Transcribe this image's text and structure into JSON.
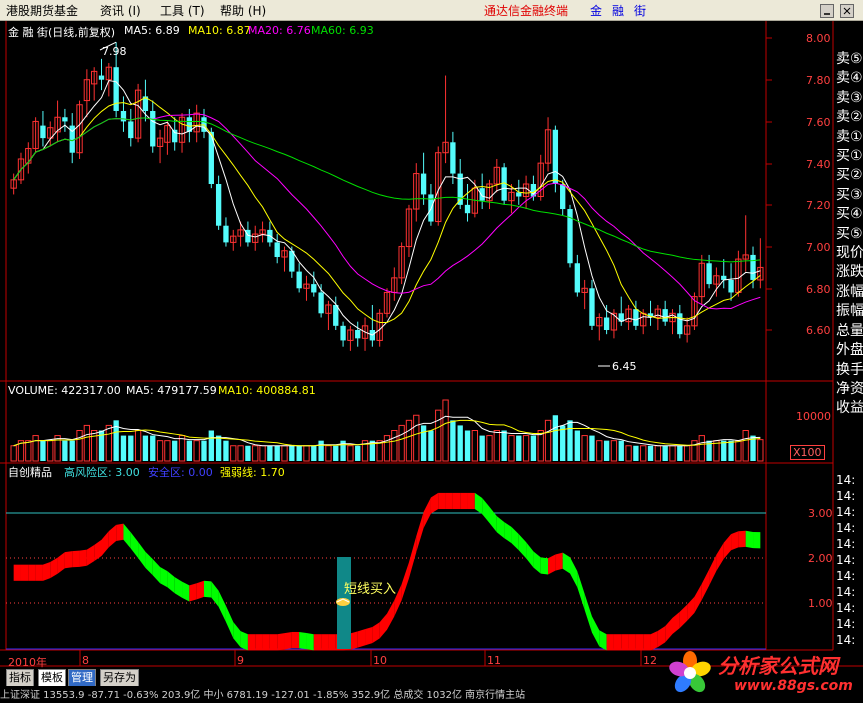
{
  "menubar": {
    "items": [
      {
        "label": "港股期货基金"
      },
      {
        "label": "资讯 (I)"
      },
      {
        "label": "工具 (T)"
      },
      {
        "label": "帮助 (H)"
      }
    ],
    "terminal_title": "通达信金融终端",
    "brand": [
      "金",
      "融",
      "街"
    ],
    "window_controls": [
      "minimize-icon",
      "close-icon"
    ]
  },
  "price_panel": {
    "stock_label": "金 融 街(日线,前复权)",
    "ma5": "MA5: 6.89",
    "ma10": "MA10: 6.87",
    "ma20": "MA20: 6.76",
    "ma60": "MA60: 6.93",
    "high_label": "7.98",
    "low_label": "6.45",
    "y_ticks": [
      "8.00",
      "7.80",
      "7.60",
      "7.40",
      "7.20",
      "7.00",
      "6.80",
      "6.60"
    ]
  },
  "volume_panel": {
    "label": "VOLUME: 422317.00",
    "ma5": "MA5: 479177.59",
    "ma10": "MA10: 400884.81",
    "tick": "10000",
    "unit": "X100"
  },
  "indicator_panel": {
    "name": "自创精品",
    "high_risk": "高风险区: 3.00",
    "safe": "安全区: 0.00",
    "strength": "强弱线: 1.70",
    "signal_text": "短线买入",
    "y_ticks": [
      "3.00",
      "2.00",
      "1.00"
    ]
  },
  "x_axis": {
    "labels": [
      "2010年",
      "8",
      "9",
      "10",
      "11",
      "12"
    ]
  },
  "side_panel": {
    "labels": [
      "卖⑤",
      "卖④",
      "卖③",
      "卖②",
      "卖①",
      "买①",
      "买②",
      "买③",
      "买④",
      "买⑤",
      "现价",
      "涨跌",
      "涨幅",
      "振幅",
      "总量",
      "外盘",
      "换手",
      "净资",
      "收益"
    ],
    "times": [
      "14:",
      "14:",
      "14:",
      "14:",
      "14:",
      "14:",
      "14:",
      "14:",
      "14:",
      "14:",
      "14:"
    ]
  },
  "bottom_tabs": [
    "指标",
    "模板",
    "管理",
    "另存为"
  ],
  "status_bar": {
    "text": "上证深证 13553.9  -87.71  -0.63%  203.9亿  中小 6781.19  -127.01  -1.85%  352.9亿  总成交  1032亿  南京行情主站"
  },
  "watermark": {
    "title": "分析家公式网",
    "url": "www.88gs.com"
  },
  "colors": {
    "up": "#ff3232",
    "down": "#54fcfc",
    "ma5": "#ffffff",
    "ma10": "#ffff00",
    "ma20": "#ff00ff",
    "ma60": "#00e000",
    "band_up": "#ff0000",
    "band_down": "#00ff00"
  },
  "chart_data": [
    {
      "type": "candlestick",
      "title": "金 融 街(日线,前复权)",
      "ylim": [
        6.45,
        8.0
      ],
      "grid": false,
      "candles_ohlc": [
        [
          7.28,
          7.35,
          7.25,
          7.32
        ],
        [
          7.32,
          7.45,
          7.3,
          7.42
        ],
        [
          7.4,
          7.5,
          7.35,
          7.47
        ],
        [
          7.47,
          7.62,
          7.45,
          7.6
        ],
        [
          7.58,
          7.65,
          7.48,
          7.52
        ],
        [
          7.52,
          7.6,
          7.48,
          7.57
        ],
        [
          7.55,
          7.7,
          7.5,
          7.62
        ],
        [
          7.62,
          7.66,
          7.55,
          7.6
        ],
        [
          7.58,
          7.64,
          7.4,
          7.45
        ],
        [
          7.45,
          7.7,
          7.42,
          7.68
        ],
        [
          7.7,
          7.85,
          7.62,
          7.8
        ],
        [
          7.78,
          7.86,
          7.7,
          7.84
        ],
        [
          7.82,
          7.9,
          7.75,
          7.8
        ],
        [
          7.8,
          7.88,
          7.72,
          7.86
        ],
        [
          7.86,
          7.98,
          7.62,
          7.65
        ],
        [
          7.65,
          7.72,
          7.55,
          7.6
        ],
        [
          7.6,
          7.66,
          7.48,
          7.52
        ],
        [
          7.52,
          7.78,
          7.5,
          7.75
        ],
        [
          7.72,
          7.8,
          7.6,
          7.65
        ],
        [
          7.65,
          7.7,
          7.45,
          7.48
        ],
        [
          7.48,
          7.56,
          7.4,
          7.52
        ],
        [
          7.5,
          7.6,
          7.44,
          7.58
        ],
        [
          7.56,
          7.62,
          7.46,
          7.5
        ],
        [
          7.5,
          7.64,
          7.45,
          7.62
        ],
        [
          7.62,
          7.66,
          7.5,
          7.55
        ],
        [
          7.55,
          7.68,
          7.5,
          7.64
        ],
        [
          7.62,
          7.66,
          7.52,
          7.55
        ],
        [
          7.55,
          7.57,
          7.28,
          7.3
        ],
        [
          7.3,
          7.34,
          7.08,
          7.1
        ],
        [
          7.1,
          7.14,
          7.0,
          7.02
        ],
        [
          7.02,
          7.08,
          6.98,
          7.05
        ],
        [
          7.05,
          7.12,
          7.0,
          7.08
        ],
        [
          7.08,
          7.12,
          7.0,
          7.02
        ],
        [
          7.02,
          7.1,
          6.98,
          7.06
        ],
        [
          7.06,
          7.12,
          7.02,
          7.08
        ],
        [
          7.08,
          7.12,
          7.0,
          7.02
        ],
        [
          7.02,
          7.06,
          6.92,
          6.95
        ],
        [
          6.95,
          7.0,
          6.88,
          6.98
        ],
        [
          6.98,
          7.0,
          6.85,
          6.88
        ],
        [
          6.88,
          6.92,
          6.78,
          6.8
        ],
        [
          6.8,
          6.86,
          6.74,
          6.82
        ],
        [
          6.82,
          6.88,
          6.76,
          6.78
        ],
        [
          6.78,
          6.82,
          6.66,
          6.68
        ],
        [
          6.68,
          6.74,
          6.6,
          6.72
        ],
        [
          6.72,
          6.76,
          6.6,
          6.62
        ],
        [
          6.62,
          6.64,
          6.52,
          6.55
        ],
        [
          6.55,
          6.62,
          6.5,
          6.6
        ],
        [
          6.6,
          6.64,
          6.52,
          6.56
        ],
        [
          6.56,
          6.66,
          6.5,
          6.62
        ],
        [
          6.6,
          6.72,
          6.52,
          6.55
        ],
        [
          6.55,
          6.7,
          6.52,
          6.68
        ],
        [
          6.68,
          6.8,
          6.66,
          6.78
        ],
        [
          6.78,
          6.9,
          6.74,
          6.85
        ],
        [
          6.85,
          7.02,
          6.82,
          7.0
        ],
        [
          7.0,
          7.2,
          6.95,
          7.18
        ],
        [
          7.18,
          7.4,
          7.12,
          7.35
        ],
        [
          7.35,
          7.45,
          7.2,
          7.25
        ],
        [
          7.25,
          7.3,
          7.1,
          7.12
        ],
        [
          7.12,
          7.48,
          7.1,
          7.45
        ],
        [
          7.45,
          7.82,
          7.4,
          7.5
        ],
        [
          7.5,
          7.55,
          7.3,
          7.35
        ],
        [
          7.35,
          7.42,
          7.18,
          7.2
        ],
        [
          7.2,
          7.3,
          7.12,
          7.16
        ],
        [
          7.16,
          7.32,
          7.14,
          7.28
        ],
        [
          7.28,
          7.35,
          7.18,
          7.22
        ],
        [
          7.22,
          7.32,
          7.18,
          7.3
        ],
        [
          7.3,
          7.42,
          7.26,
          7.38
        ],
        [
          7.38,
          7.4,
          7.2,
          7.22
        ],
        [
          7.22,
          7.3,
          7.16,
          7.26
        ],
        [
          7.26,
          7.32,
          7.2,
          7.24
        ],
        [
          7.24,
          7.34,
          7.18,
          7.3
        ],
        [
          7.3,
          7.34,
          7.22,
          7.24
        ],
        [
          7.24,
          7.44,
          7.22,
          7.4
        ],
        [
          7.4,
          7.62,
          7.36,
          7.56
        ],
        [
          7.56,
          7.58,
          7.26,
          7.3
        ],
        [
          7.3,
          7.32,
          7.15,
          7.18
        ],
        [
          7.18,
          7.2,
          6.9,
          6.92
        ],
        [
          6.92,
          6.96,
          6.76,
          6.78
        ],
        [
          6.78,
          6.84,
          6.7,
          6.8
        ],
        [
          6.8,
          6.84,
          6.6,
          6.62
        ],
        [
          6.62,
          6.68,
          6.55,
          6.66
        ],
        [
          6.66,
          6.72,
          6.58,
          6.6
        ],
        [
          6.6,
          6.7,
          6.56,
          6.68
        ],
        [
          6.68,
          6.76,
          6.62,
          6.64
        ],
        [
          6.64,
          6.72,
          6.6,
          6.7
        ],
        [
          6.7,
          6.74,
          6.6,
          6.62
        ],
        [
          6.62,
          6.7,
          6.58,
          6.68
        ],
        [
          6.68,
          6.74,
          6.62,
          6.66
        ],
        [
          6.66,
          6.72,
          6.6,
          6.7
        ],
        [
          6.7,
          6.74,
          6.62,
          6.64
        ],
        [
          6.64,
          6.7,
          6.58,
          6.68
        ],
        [
          6.68,
          6.72,
          6.56,
          6.58
        ],
        [
          6.58,
          6.66,
          6.54,
          6.62
        ],
        [
          6.62,
          6.78,
          6.6,
          6.76
        ],
        [
          6.76,
          6.96,
          6.72,
          6.92
        ],
        [
          6.92,
          6.96,
          6.8,
          6.82
        ],
        [
          6.82,
          6.9,
          6.76,
          6.86
        ],
        [
          6.86,
          6.94,
          6.8,
          6.84
        ],
        [
          6.84,
          6.92,
          6.74,
          6.78
        ],
        [
          6.78,
          6.98,
          6.76,
          6.94
        ],
        [
          6.94,
          7.15,
          6.88,
          6.96
        ],
        [
          6.96,
          7.0,
          6.8,
          6.84
        ],
        [
          6.84,
          7.04,
          6.8,
          6.9
        ]
      ]
    },
    {
      "type": "bar",
      "title": "VOLUME",
      "series": [
        {
          "name": "VOLUME",
          "values": [
            3,
            4,
            4,
            5,
            4,
            4,
            5,
            4,
            4,
            6,
            7,
            6,
            6,
            7,
            8,
            5,
            5,
            6,
            5,
            5,
            4,
            4,
            4,
            5,
            4,
            4,
            4,
            6,
            5,
            4,
            3,
            3,
            3,
            3,
            3,
            3,
            3,
            3,
            3,
            3,
            3,
            3,
            4,
            3,
            3,
            4,
            3,
            3,
            4,
            4,
            4,
            5,
            6,
            7,
            8,
            9,
            7,
            6,
            10,
            12,
            8,
            7,
            6,
            6,
            5,
            5,
            6,
            6,
            5,
            5,
            5,
            5,
            6,
            8,
            9,
            7,
            8,
            6,
            5,
            5,
            4,
            4,
            4,
            4,
            3,
            3,
            3,
            3,
            3,
            3,
            3,
            3,
            3,
            4,
            5,
            4,
            4,
            4,
            4,
            4,
            6,
            5,
            4.2
          ]
        }
      ]
    },
    {
      "type": "area",
      "title": "自创精品",
      "ylim": [
        0,
        3.5
      ],
      "series": [
        {
          "name": "高风险区",
          "values": [
            3.0
          ]
        },
        {
          "name": "安全区",
          "values": [
            0.0
          ]
        },
        {
          "name": "强弱线",
          "values": [
            1.7
          ]
        }
      ]
    }
  ]
}
